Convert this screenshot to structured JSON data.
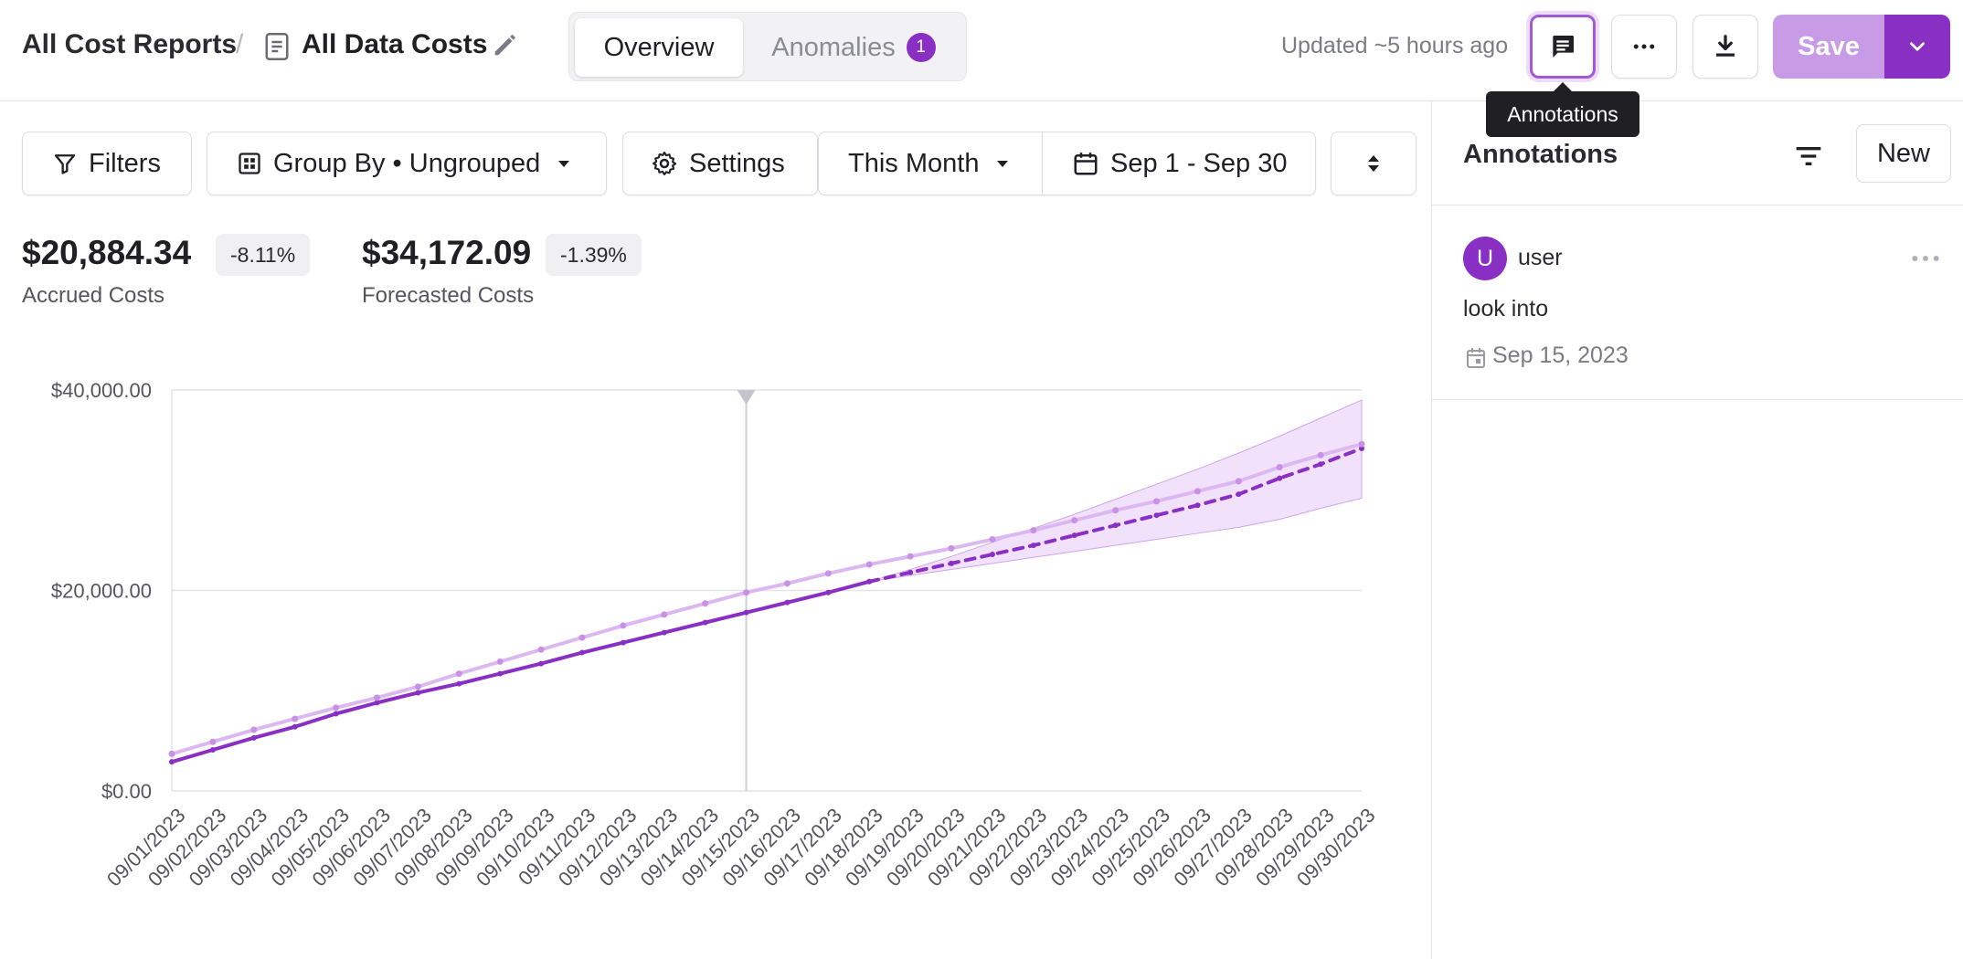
{
  "header": {
    "breadcrumb_root": "All Cost Reports",
    "breadcrumb_separator": "/",
    "report_title": "All Data Costs",
    "tabs": [
      {
        "label": "Overview",
        "active": true
      },
      {
        "label": "Anomalies",
        "active": false,
        "badge": "1"
      }
    ],
    "updated_text": "Updated ~5 hours ago",
    "annotations_tooltip": "Annotations",
    "save_label": "Save",
    "icons": [
      "document-icon",
      "pencil-icon",
      "comment-icon",
      "more-horizontal-icon",
      "download-icon",
      "chevron-down-icon"
    ]
  },
  "toolbar": {
    "filters_label": "Filters",
    "group_by_label": "Group By • Ungrouped",
    "settings_label": "Settings",
    "period_label": "This Month",
    "date_range_label": "Sep 1 - Sep 30"
  },
  "metrics": {
    "accrued": {
      "value": "$20,884.34",
      "change": "-8.11%",
      "label": "Accrued Costs"
    },
    "forecasted": {
      "value": "$34,172.09",
      "change": "-1.39%",
      "label": "Forecasted Costs"
    }
  },
  "chart_data": {
    "type": "line",
    "title": "",
    "xlabel": "",
    "ylabel": "",
    "x": [
      "09/01/2023",
      "09/02/2023",
      "09/03/2023",
      "09/04/2023",
      "09/05/2023",
      "09/06/2023",
      "09/07/2023",
      "09/08/2023",
      "09/09/2023",
      "09/10/2023",
      "09/11/2023",
      "09/12/2023",
      "09/13/2023",
      "09/14/2023",
      "09/15/2023",
      "09/16/2023",
      "09/17/2023",
      "09/18/2023",
      "09/19/2023",
      "09/20/2023",
      "09/21/2023",
      "09/22/2023",
      "09/23/2023",
      "09/24/2023",
      "09/25/2023",
      "09/26/2023",
      "09/27/2023",
      "09/28/2023",
      "09/29/2023",
      "09/30/2023"
    ],
    "y_ticks": [
      "$0.00",
      "$20,000.00",
      "$40,000.00"
    ],
    "ylim": [
      0,
      40000
    ],
    "grid": true,
    "annotation_marker_x": "09/15/2023",
    "series": [
      {
        "role": "accrued",
        "style": "solid",
        "color": "#8a2fc4",
        "values": [
          2900,
          4100,
          5300,
          6400,
          7700,
          8800,
          9800,
          10700,
          11700,
          12700,
          13800,
          14800,
          15800,
          16800,
          17800,
          18800,
          19800,
          20884,
          null,
          null,
          null,
          null,
          null,
          null,
          null,
          null,
          null,
          null,
          null,
          null
        ]
      },
      {
        "role": "forecast",
        "style": "dashed",
        "color": "#8a2fc4",
        "values": [
          null,
          null,
          null,
          null,
          null,
          null,
          null,
          null,
          null,
          null,
          null,
          null,
          null,
          null,
          null,
          null,
          null,
          20884,
          21800,
          22700,
          23600,
          24500,
          25500,
          26500,
          27500,
          28500,
          29600,
          31200,
          32600,
          34172
        ]
      },
      {
        "role": "previous-period",
        "style": "solid",
        "color": "#dcb8f0",
        "values": [
          3700,
          4900,
          6100,
          7200,
          8300,
          9300,
          10400,
          11700,
          12900,
          14100,
          15300,
          16500,
          17600,
          18700,
          19800,
          20700,
          21700,
          22600,
          23400,
          24200,
          25100,
          26000,
          27000,
          28000,
          28900,
          29900,
          30900,
          32300,
          33500,
          34600
        ]
      },
      {
        "role": "forecast-band",
        "color": "#eedcfa",
        "lower": [
          null,
          null,
          null,
          null,
          null,
          null,
          null,
          null,
          null,
          null,
          null,
          null,
          null,
          null,
          null,
          null,
          null,
          20884,
          21500,
          22100,
          22700,
          23300,
          23900,
          24500,
          25100,
          25700,
          26300,
          27100,
          28200,
          29200
        ],
        "upper": [
          null,
          null,
          null,
          null,
          null,
          null,
          null,
          null,
          null,
          null,
          null,
          null,
          null,
          null,
          null,
          null,
          null,
          20884,
          22100,
          23400,
          24800,
          26200,
          27600,
          29100,
          30600,
          32100,
          33700,
          35400,
          37200,
          39000
        ]
      }
    ]
  },
  "annotations_panel": {
    "title": "Annotations",
    "new_label": "New",
    "items": [
      {
        "avatar_letter": "U",
        "user": "user",
        "text": "look into",
        "date": "Sep 15, 2023"
      }
    ]
  }
}
